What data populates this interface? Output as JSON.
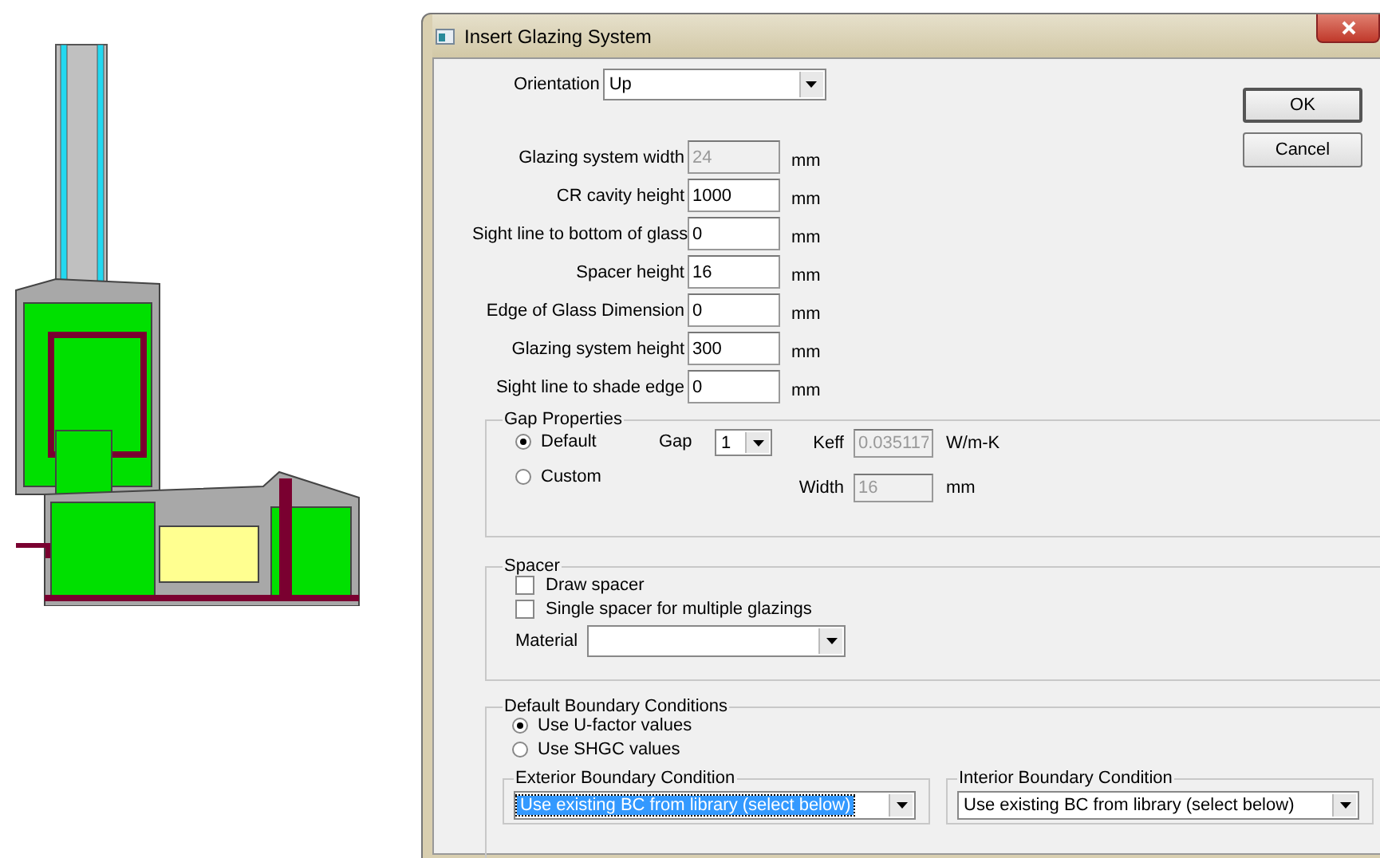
{
  "window": {
    "title": "Insert Glazing System"
  },
  "orientation": {
    "label": "Orientation",
    "value": "Up"
  },
  "buttons": [
    {
      "label": "OK",
      "default": true
    },
    {
      "label": "Cancel",
      "default": false
    }
  ],
  "fields": [
    {
      "label": "Glazing system width",
      "value": "24",
      "unit": "mm",
      "disabled": true
    },
    {
      "label": "CR cavity height",
      "value": "1000",
      "unit": "mm",
      "disabled": false
    },
    {
      "label": "Sight line to bottom of glass",
      "value": "0",
      "unit": "mm",
      "disabled": false
    },
    {
      "label": "Spacer height",
      "value": "16",
      "unit": "mm",
      "disabled": false
    },
    {
      "label": "Edge of Glass Dimension",
      "value": "0",
      "unit": "mm",
      "disabled": false
    },
    {
      "label": "Glazing system height",
      "value": "300",
      "unit": "mm",
      "disabled": false
    },
    {
      "label": "Sight line to shade edge",
      "value": "0",
      "unit": "mm",
      "disabled": false
    }
  ],
  "gap_properties": {
    "title": "Gap Properties",
    "options": [
      {
        "label": "Default",
        "selected": true
      },
      {
        "label": "Custom",
        "selected": false
      }
    ],
    "gap": {
      "label": "Gap",
      "value": "1"
    },
    "keff": {
      "label": "Keff",
      "value": "0.035117",
      "unit": "W/m-K",
      "disabled": true
    },
    "width": {
      "label": "Width",
      "value": "16",
      "unit": "mm",
      "disabled": true
    }
  },
  "spacer": {
    "title": "Spacer",
    "checkboxes": [
      {
        "label": "Draw spacer",
        "checked": false
      },
      {
        "label": "Single spacer for multiple glazings",
        "checked": false
      }
    ],
    "material": {
      "label": "Material"
    }
  },
  "boundary": {
    "title": "Default Boundary Conditions",
    "options": [
      {
        "label": "Use U-factor values",
        "selected": true
      },
      {
        "label": "Use SHGC values",
        "selected": false
      }
    ],
    "groups": [
      {
        "title": "Exterior Boundary Condition",
        "value": "Use existing BC from library (select below)",
        "focused": true
      },
      {
        "title": "Interior Boundary Condition",
        "value": "Use existing BC from library (select below)",
        "focused": false
      }
    ]
  }
}
